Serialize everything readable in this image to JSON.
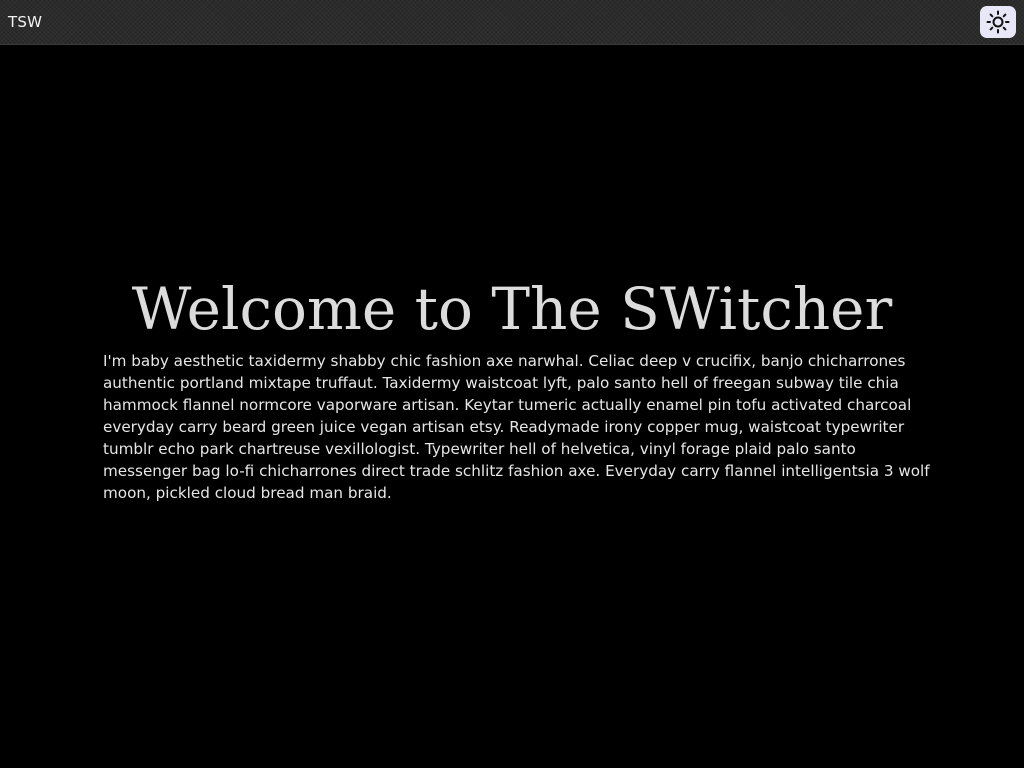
{
  "header": {
    "brand": "TSW",
    "theme_toggle_icon": "sun-icon"
  },
  "main": {
    "heading": "Welcome to The SWitcher",
    "paragraph": "I'm baby aesthetic taxidermy shabby chic fashion axe narwhal. Celiac deep v crucifix, banjo chicharrones authentic portland mixtape truffaut. Taxidermy waistcoat lyft, palo santo hell of freegan subway tile chia hammock flannel normcore vaporware artisan. Keytar tumeric actually enamel pin tofu activated charcoal everyday carry beard green juice vegan artisan etsy. Readymade irony copper mug, waistcoat typewriter tumblr echo park chartreuse vexillologist. Typewriter hell of helvetica, vinyl forage plaid palo santo messenger bag lo-fi chicharrones direct trade schlitz fashion axe. Everyday carry flannel intelligentsia 3 wolf moon, pickled cloud bread man braid."
  },
  "colors": {
    "page_background": "#000000",
    "header_background": "#2b2b2b",
    "toggle_background": "#e7e7f7",
    "heading_text": "#dcdcdc",
    "body_text": "#e6e6e6"
  }
}
